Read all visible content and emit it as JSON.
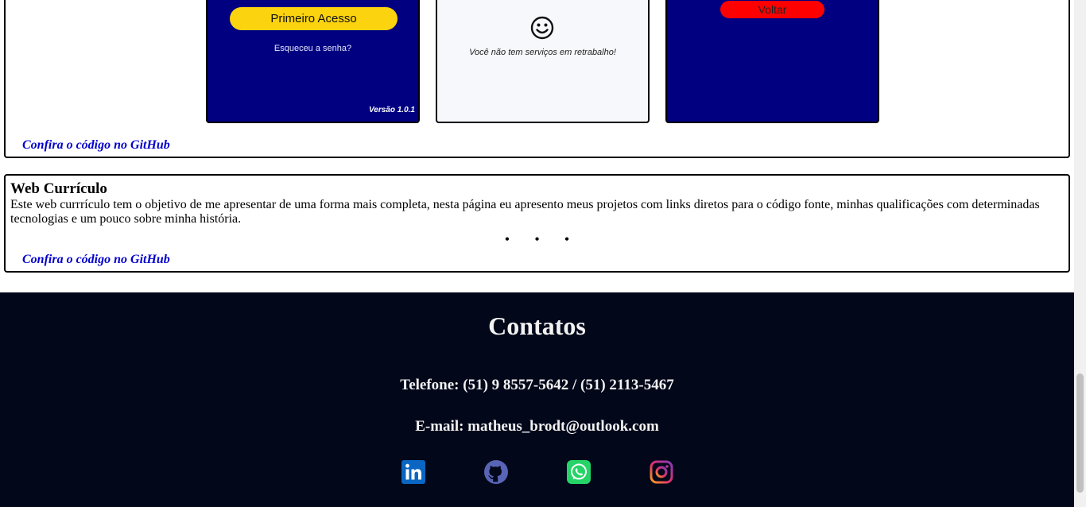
{
  "project_1": {
    "login_screen": {
      "primary_button": "Primeiro Acesso",
      "forgot_link": "Esqueceu a senha?",
      "version": "Versão 1.0.1"
    },
    "empty_screen": {
      "icon": "smiley-icon",
      "message": "Você não tem serviços em retrabalho!"
    },
    "back_screen": {
      "back_button": "Voltar"
    },
    "github_link": "Confira o código no GitHub"
  },
  "project_2": {
    "title": "Web Currículo",
    "description": "Este web currrículo tem o objetivo de me apresentar de uma forma mais completa, nesta página eu apresento meus projetos com links diretos para o código fonte, minhas qualificações com determinadas tecnologias e um pouco sobre minha história.",
    "ellipsis": "• • •",
    "github_link": "Confira o código no GitHub"
  },
  "footer": {
    "title": "Contatos",
    "phone": "Telefone: (51) 9 8557-5642 / (51) 2113-5467",
    "email": "E-mail: matheus_brodt@outlook.com",
    "social": [
      "linkedin-icon",
      "github-icon",
      "whatsapp-icon",
      "instagram-icon"
    ]
  },
  "colors": {
    "app_blue": "#000080",
    "accent_yellow": "#fbd30e",
    "accent_red": "#ff0000",
    "footer_bg": "#02071a",
    "link_blue": "#0000cc"
  }
}
